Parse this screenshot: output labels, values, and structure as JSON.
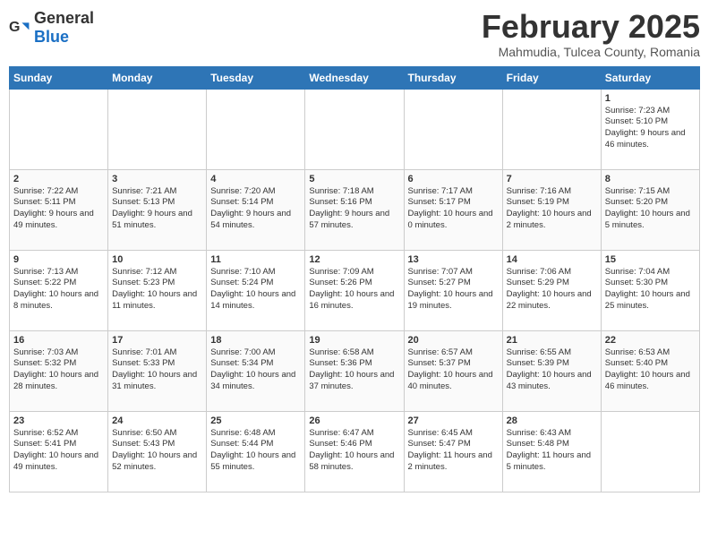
{
  "header": {
    "logo_general": "General",
    "logo_blue": "Blue",
    "month_title": "February 2025",
    "location": "Mahmudia, Tulcea County, Romania"
  },
  "weekdays": [
    "Sunday",
    "Monday",
    "Tuesday",
    "Wednesday",
    "Thursday",
    "Friday",
    "Saturday"
  ],
  "weeks": [
    [
      {
        "day": "",
        "info": ""
      },
      {
        "day": "",
        "info": ""
      },
      {
        "day": "",
        "info": ""
      },
      {
        "day": "",
        "info": ""
      },
      {
        "day": "",
        "info": ""
      },
      {
        "day": "",
        "info": ""
      },
      {
        "day": "1",
        "info": "Sunrise: 7:23 AM\nSunset: 5:10 PM\nDaylight: 9 hours and 46 minutes."
      }
    ],
    [
      {
        "day": "2",
        "info": "Sunrise: 7:22 AM\nSunset: 5:11 PM\nDaylight: 9 hours and 49 minutes."
      },
      {
        "day": "3",
        "info": "Sunrise: 7:21 AM\nSunset: 5:13 PM\nDaylight: 9 hours and 51 minutes."
      },
      {
        "day": "4",
        "info": "Sunrise: 7:20 AM\nSunset: 5:14 PM\nDaylight: 9 hours and 54 minutes."
      },
      {
        "day": "5",
        "info": "Sunrise: 7:18 AM\nSunset: 5:16 PM\nDaylight: 9 hours and 57 minutes."
      },
      {
        "day": "6",
        "info": "Sunrise: 7:17 AM\nSunset: 5:17 PM\nDaylight: 10 hours and 0 minutes."
      },
      {
        "day": "7",
        "info": "Sunrise: 7:16 AM\nSunset: 5:19 PM\nDaylight: 10 hours and 2 minutes."
      },
      {
        "day": "8",
        "info": "Sunrise: 7:15 AM\nSunset: 5:20 PM\nDaylight: 10 hours and 5 minutes."
      }
    ],
    [
      {
        "day": "9",
        "info": "Sunrise: 7:13 AM\nSunset: 5:22 PM\nDaylight: 10 hours and 8 minutes."
      },
      {
        "day": "10",
        "info": "Sunrise: 7:12 AM\nSunset: 5:23 PM\nDaylight: 10 hours and 11 minutes."
      },
      {
        "day": "11",
        "info": "Sunrise: 7:10 AM\nSunset: 5:24 PM\nDaylight: 10 hours and 14 minutes."
      },
      {
        "day": "12",
        "info": "Sunrise: 7:09 AM\nSunset: 5:26 PM\nDaylight: 10 hours and 16 minutes."
      },
      {
        "day": "13",
        "info": "Sunrise: 7:07 AM\nSunset: 5:27 PM\nDaylight: 10 hours and 19 minutes."
      },
      {
        "day": "14",
        "info": "Sunrise: 7:06 AM\nSunset: 5:29 PM\nDaylight: 10 hours and 22 minutes."
      },
      {
        "day": "15",
        "info": "Sunrise: 7:04 AM\nSunset: 5:30 PM\nDaylight: 10 hours and 25 minutes."
      }
    ],
    [
      {
        "day": "16",
        "info": "Sunrise: 7:03 AM\nSunset: 5:32 PM\nDaylight: 10 hours and 28 minutes."
      },
      {
        "day": "17",
        "info": "Sunrise: 7:01 AM\nSunset: 5:33 PM\nDaylight: 10 hours and 31 minutes."
      },
      {
        "day": "18",
        "info": "Sunrise: 7:00 AM\nSunset: 5:34 PM\nDaylight: 10 hours and 34 minutes."
      },
      {
        "day": "19",
        "info": "Sunrise: 6:58 AM\nSunset: 5:36 PM\nDaylight: 10 hours and 37 minutes."
      },
      {
        "day": "20",
        "info": "Sunrise: 6:57 AM\nSunset: 5:37 PM\nDaylight: 10 hours and 40 minutes."
      },
      {
        "day": "21",
        "info": "Sunrise: 6:55 AM\nSunset: 5:39 PM\nDaylight: 10 hours and 43 minutes."
      },
      {
        "day": "22",
        "info": "Sunrise: 6:53 AM\nSunset: 5:40 PM\nDaylight: 10 hours and 46 minutes."
      }
    ],
    [
      {
        "day": "23",
        "info": "Sunrise: 6:52 AM\nSunset: 5:41 PM\nDaylight: 10 hours and 49 minutes."
      },
      {
        "day": "24",
        "info": "Sunrise: 6:50 AM\nSunset: 5:43 PM\nDaylight: 10 hours and 52 minutes."
      },
      {
        "day": "25",
        "info": "Sunrise: 6:48 AM\nSunset: 5:44 PM\nDaylight: 10 hours and 55 minutes."
      },
      {
        "day": "26",
        "info": "Sunrise: 6:47 AM\nSunset: 5:46 PM\nDaylight: 10 hours and 58 minutes."
      },
      {
        "day": "27",
        "info": "Sunrise: 6:45 AM\nSunset: 5:47 PM\nDaylight: 11 hours and 2 minutes."
      },
      {
        "day": "28",
        "info": "Sunrise: 6:43 AM\nSunset: 5:48 PM\nDaylight: 11 hours and 5 minutes."
      },
      {
        "day": "",
        "info": ""
      }
    ]
  ]
}
